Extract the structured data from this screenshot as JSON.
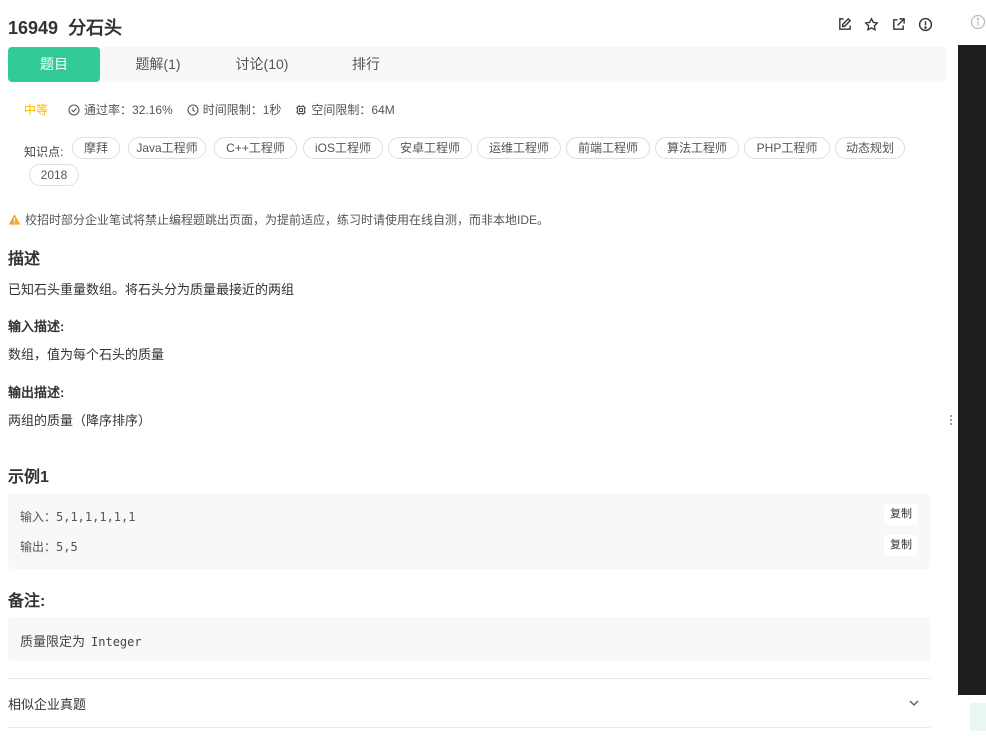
{
  "problem": {
    "number": "16949",
    "title": "分石头"
  },
  "toolbar_icons": [
    "edit-icon",
    "star-icon",
    "external-link-icon",
    "report-icon"
  ],
  "tabs": [
    {
      "label": "题目"
    },
    {
      "label": "题解(1)"
    },
    {
      "label": "讨论(10)"
    },
    {
      "label": "排行"
    }
  ],
  "meta": {
    "difficulty": "中等",
    "pass_rate": "通过率：32.16%",
    "time_limit": "时间限制：1秒",
    "space_limit": "空间限制：64M"
  },
  "knowledge": {
    "label": "知识点:",
    "tags": [
      "摩拜",
      "Java工程师",
      "C++工程师",
      "iOS工程师",
      "安卓工程师",
      "运维工程师",
      "前端工程师",
      "算法工程师",
      "PHP工程师",
      "动态规划",
      "2018"
    ]
  },
  "warning": "校招时部分企业笔试将禁止编程题跳出页面，为提前适应，练习时请使用在线自测，而非本地IDE。",
  "description": {
    "heading": "描述",
    "text": "已知石头重量数组。将石头分为质量最接近的两组"
  },
  "input_desc": {
    "heading": "输入描述:",
    "text": "数组，值为每个石头的质量"
  },
  "output_desc": {
    "heading": "输出描述:",
    "text": "两组的质量（降序排序）"
  },
  "example": {
    "heading": "示例1",
    "input": "输入：5,1,1,1,1,1",
    "output": "输出：5,5",
    "copy_label": "复制"
  },
  "note": {
    "heading": "备注:",
    "text": "质量限定为",
    "code": "Integer"
  },
  "similar": {
    "label": "相似企业真题"
  },
  "colors": {
    "accent": "#32ca99",
    "difficulty_medium": "#ffb800",
    "warning": "#f5a623",
    "editor_bg": "#1e1e1e"
  }
}
